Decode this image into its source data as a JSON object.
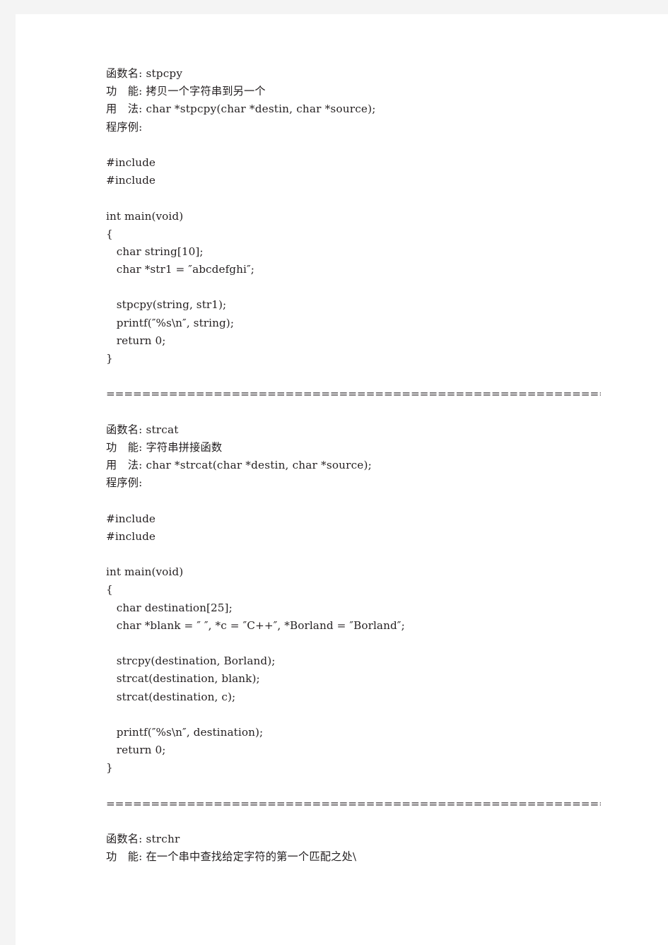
{
  "page": {
    "background_color": "#ffffff",
    "margin_color": "#f4f4f4",
    "text_color": "#231f20"
  },
  "document": {
    "separator": "================================================================",
    "sections": [
      {
        "name": "stpcpy",
        "header": [
          "函数名: stpcpy",
          "功　能: 拷贝一个字符串到另一个",
          "用　法: char *stpcpy(char *destin, char *source);",
          "程序例:"
        ],
        "code": [
          "#include",
          "#include",
          "",
          "int main(void)",
          "{",
          "   char string[10];",
          "   char *str1 = ″abcdefghi″;",
          "",
          "   stpcpy(string, str1);",
          "   printf(″%s\\n″, string);",
          "   return 0;",
          "}"
        ]
      },
      {
        "name": "strcat",
        "header": [
          "函数名: strcat",
          "功　能: 字符串拼接函数",
          "用　法: char *strcat(char *destin, char *source);",
          "程序例:"
        ],
        "code": [
          "#include",
          "#include",
          "",
          "int main(void)",
          "{",
          "   char destination[25];",
          "   char *blank = ″ ″, *c = ″C++″, *Borland = ″Borland″;",
          "",
          "   strcpy(destination, Borland);",
          "   strcat(destination, blank);",
          "   strcat(destination, c);",
          "",
          "   printf(″%s\\n″, destination);",
          "   return 0;",
          "}"
        ]
      },
      {
        "name": "strchr",
        "header": [
          "函数名: strchr",
          "功　能: 在一个串中查找给定字符的第一个匹配之处\\"
        ],
        "code": []
      }
    ]
  },
  "lines": {
    "l1": "函数名: stpcpy",
    "l2": "功　能: 拷贝一个字符串到另一个",
    "l3": "用　法: char *stpcpy(char *destin, char *source);",
    "l4": "程序例:",
    "l5": "",
    "l6": "#include",
    "l7": "#include",
    "l8": "",
    "l9": "int main(void)",
    "l10": "{",
    "l11": "   char string[10];",
    "l12": "   char *str1 = ″abcdefghi″;",
    "l13": "",
    "l14": "   stpcpy(string, str1);",
    "l15": "   printf(″%s\\n″, string);",
    "l16": "   return 0;",
    "l17": "}",
    "l18": "",
    "l19": "================================================================",
    "l20": "",
    "l21": "函数名: strcat",
    "l22": "功　能: 字符串拼接函数",
    "l23": "用　法: char *strcat(char *destin, char *source);",
    "l24": "程序例:",
    "l25": "",
    "l26": "#include",
    "l27": "#include",
    "l28": "",
    "l29": "int main(void)",
    "l30": "{",
    "l31": "   char destination[25];",
    "l32": "   char *blank = ″ ″, *c = ″C++″, *Borland = ″Borland″;",
    "l33": "",
    "l34": "   strcpy(destination, Borland);",
    "l35": "   strcat(destination, blank);",
    "l36": "   strcat(destination, c);",
    "l37": "",
    "l38": "   printf(″%s\\n″, destination);",
    "l39": "   return 0;",
    "l40": "}",
    "l41": "",
    "l42": "================================================================",
    "l43": "",
    "l44": "函数名: strchr",
    "l45": "功　能: 在一个串中查找给定字符的第一个匹配之处\\"
  }
}
